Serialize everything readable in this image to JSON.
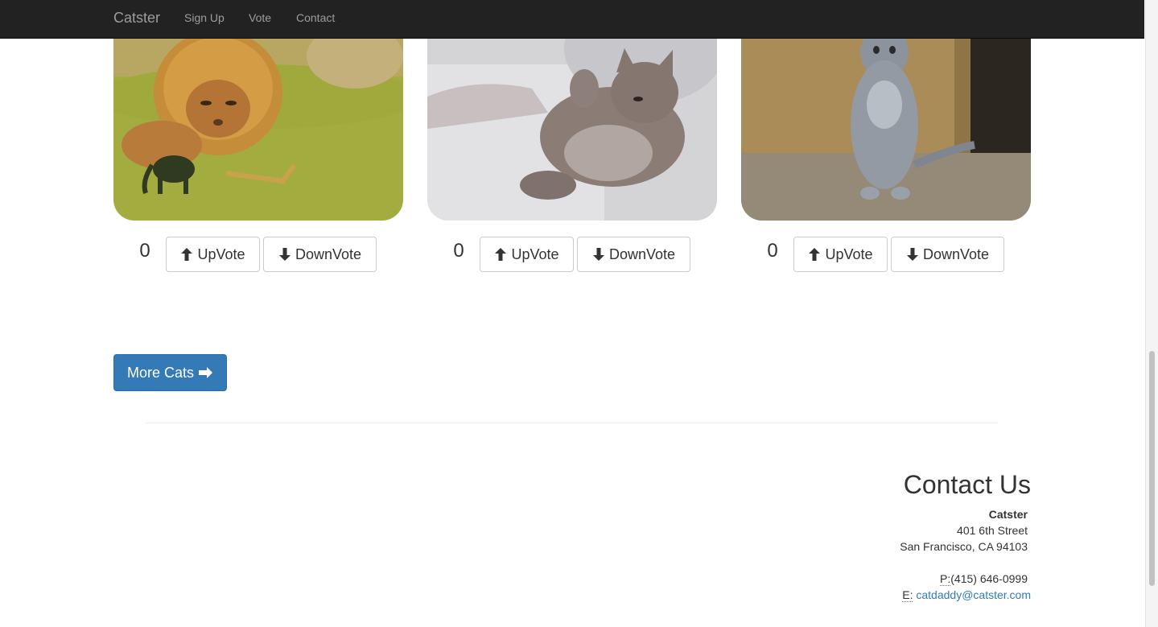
{
  "navbar": {
    "brand": "Catster",
    "links": [
      "Sign Up",
      "Vote",
      "Contact"
    ]
  },
  "cats": [
    {
      "image": "lion-mane-cat-gif",
      "votes": "0",
      "upvote_label": "UpVote",
      "downvote_label": "DownVote"
    },
    {
      "image": "kitten-playing-gif",
      "votes": "0",
      "upvote_label": "UpVote",
      "downvote_label": "DownVote"
    },
    {
      "image": "standing-gray-cat-gif",
      "votes": "0",
      "upvote_label": "UpVote",
      "downvote_label": "DownVote"
    }
  ],
  "icons": {
    "upvote": "arrow-up-icon",
    "downvote": "arrow-down-icon",
    "more": "arrow-right-icon"
  },
  "more_button": {
    "label": "More Cats"
  },
  "contact": {
    "title": "Contact Us",
    "company": "Catster",
    "street": "401 6th Street",
    "city": "San Francisco, CA 94103",
    "phone_prefix": "P:",
    "phone": "(415) 646-0999",
    "email_prefix": "E:",
    "email": "catdaddy@catster.com"
  },
  "colors": {
    "navbar_bg": "#222222",
    "nav_text": "#9d9d9d",
    "primary": "#337ab7",
    "link": "#337ab7"
  }
}
